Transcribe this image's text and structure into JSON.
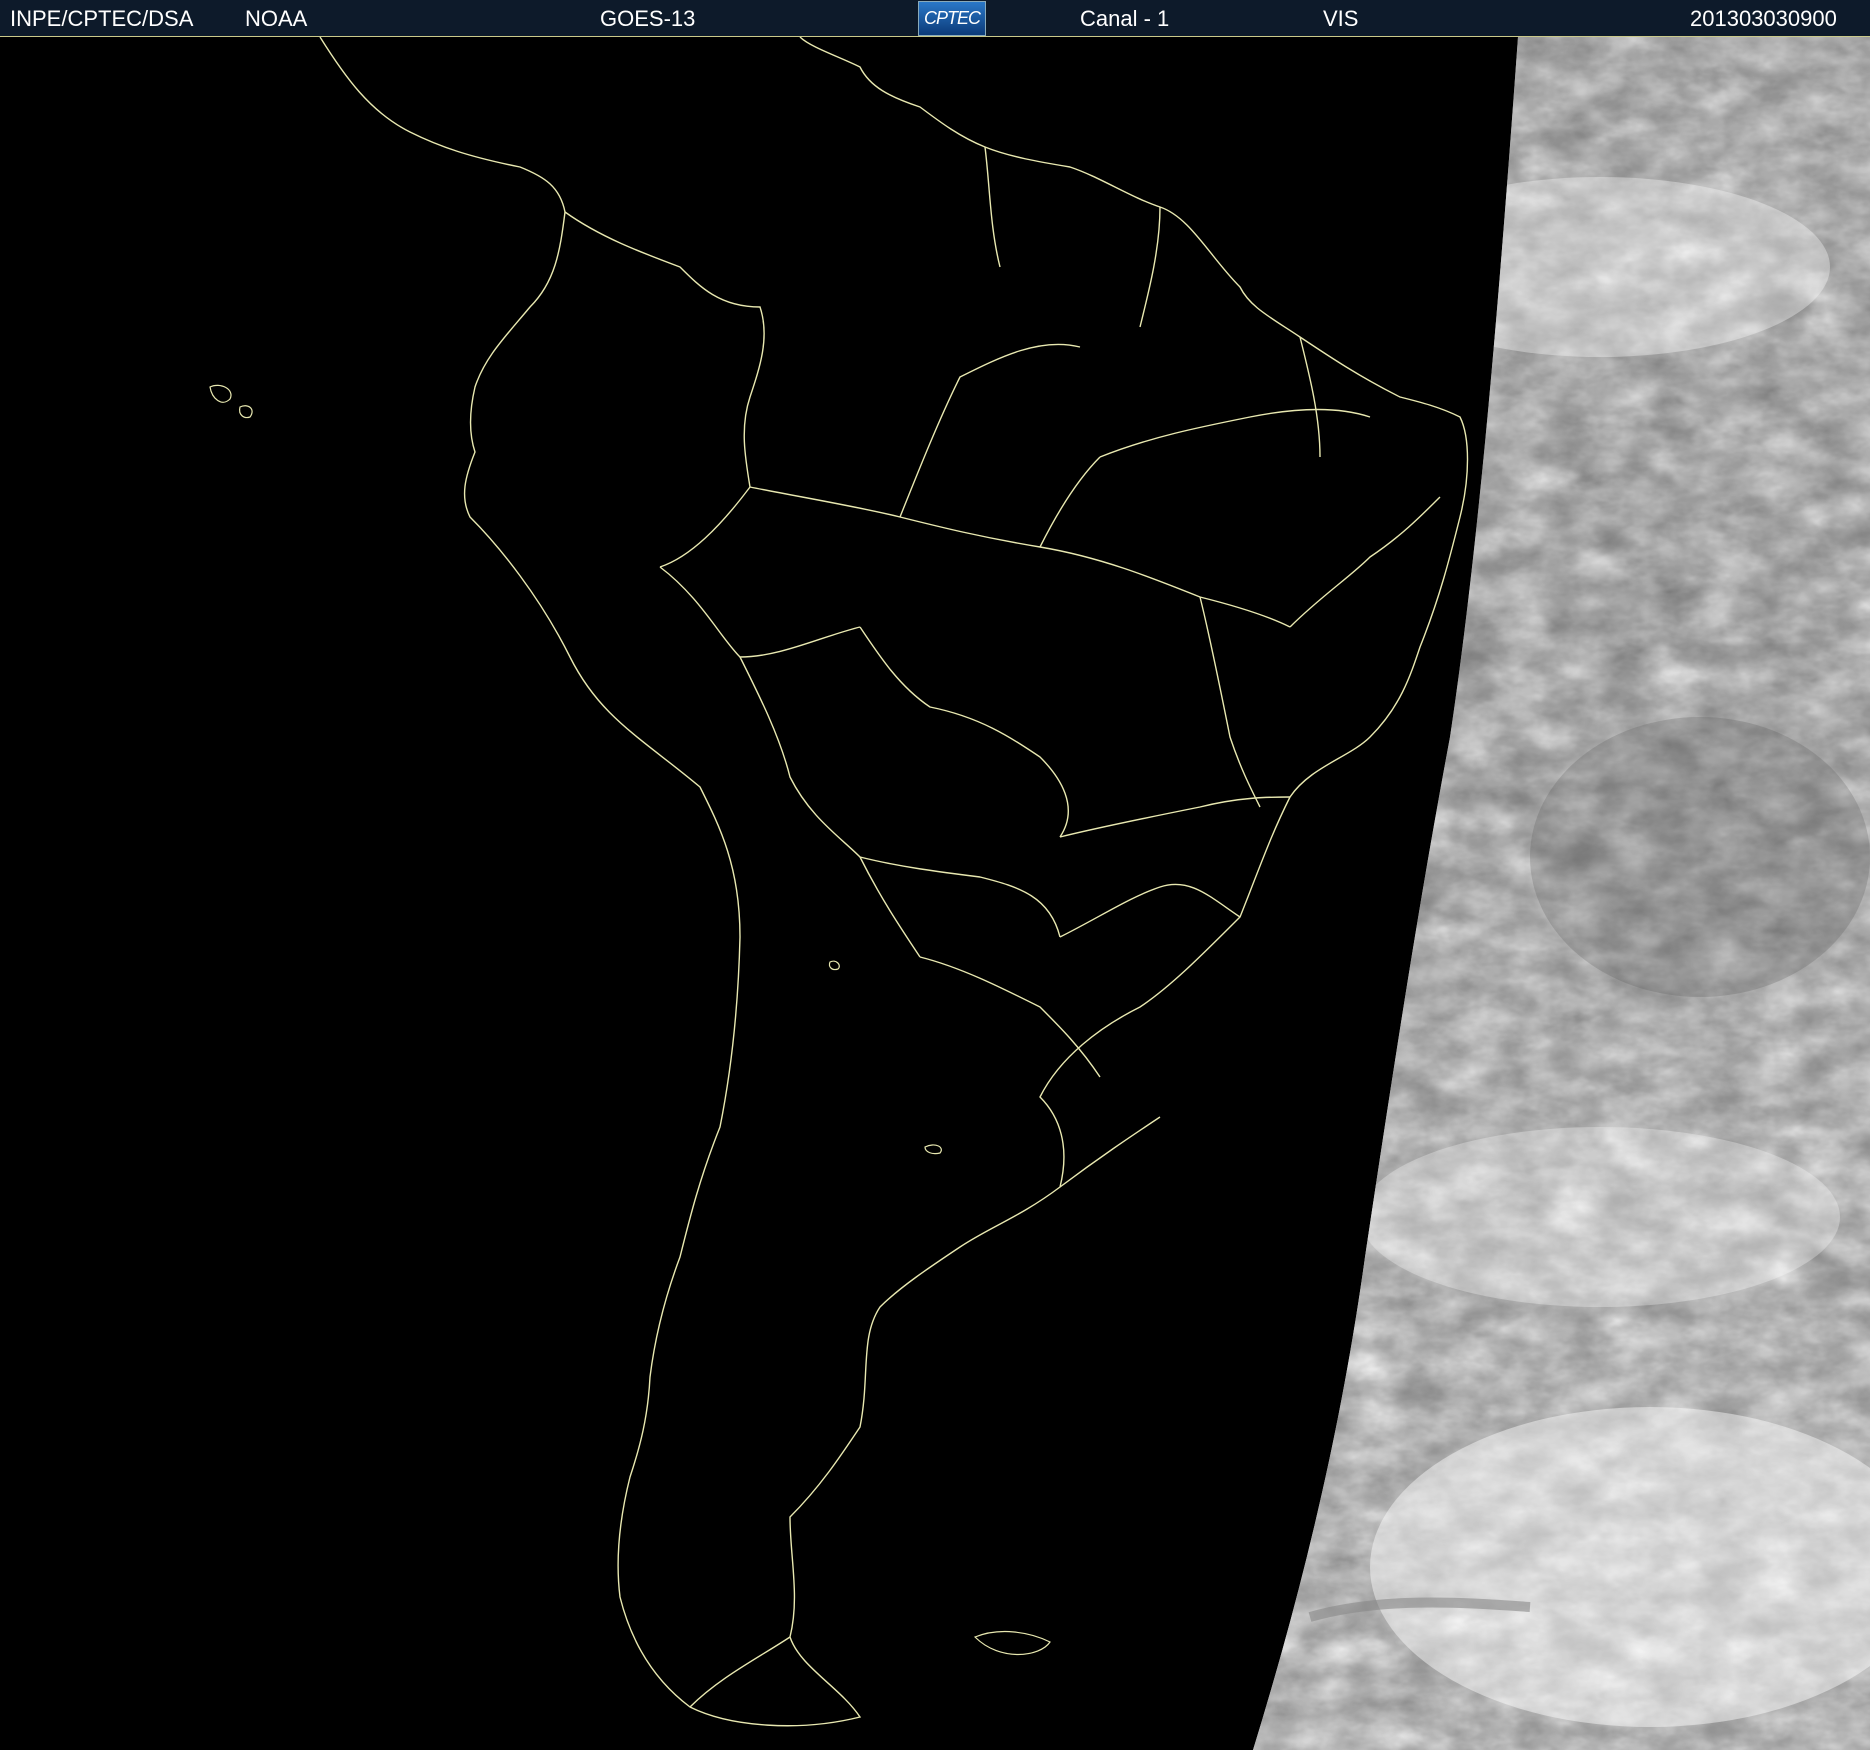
{
  "header": {
    "agency": "INPE/CPTEC/DSA",
    "source": "NOAA",
    "satellite": "GOES-13",
    "logo_text": "CPTEC",
    "channel": "Canal - 1",
    "band": "VIS",
    "timestamp": "201303030900"
  },
  "colors": {
    "header_bg": "#0d1a2a",
    "coastline": "#e8e8b0",
    "night_side": "#000000",
    "cloud_white": "#f2f2f2",
    "cloud_gray": "#8a8a8a"
  }
}
